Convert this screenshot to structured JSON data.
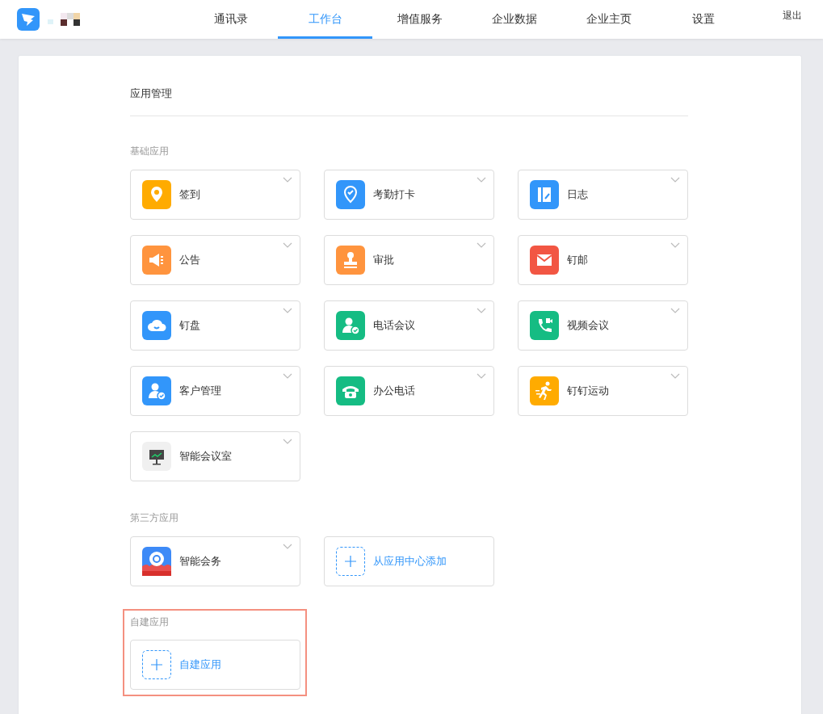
{
  "nav": {
    "tabs": [
      {
        "label": "通讯录",
        "selected": false
      },
      {
        "label": "工作台",
        "selected": true
      },
      {
        "label": "增值服务",
        "selected": false
      },
      {
        "label": "企业数据",
        "selected": false
      },
      {
        "label": "企业主页",
        "selected": false
      },
      {
        "label": "设置",
        "selected": false
      }
    ],
    "logout": "退出"
  },
  "panel": {
    "title": "应用管理",
    "sections": [
      {
        "title": "基础应用",
        "highlighted": false,
        "apps": [
          {
            "kind": "app",
            "name": "签到",
            "color": "#ffab00"
          },
          {
            "kind": "app",
            "name": "考勤打卡",
            "color": "#3296fa"
          },
          {
            "kind": "app",
            "name": "日志",
            "color": "#3296fa"
          },
          {
            "kind": "app",
            "name": "公告",
            "color": "#ff943e"
          },
          {
            "kind": "app",
            "name": "审批",
            "color": "#ff943e"
          },
          {
            "kind": "app",
            "name": "钉邮",
            "color": "#f25643"
          },
          {
            "kind": "app",
            "name": "钉盘",
            "color": "#3296fa"
          },
          {
            "kind": "app",
            "name": "电话会议",
            "color": "#15bc83"
          },
          {
            "kind": "app",
            "name": "视频会议",
            "color": "#15bc83"
          },
          {
            "kind": "app",
            "name": "客户管理",
            "color": "#3296fa"
          },
          {
            "kind": "app",
            "name": "办公电话",
            "color": "#15bc83"
          },
          {
            "kind": "app",
            "name": "钉钉运动",
            "color": "#ffab00"
          },
          {
            "kind": "app",
            "name": "智能会议室",
            "color": "#f0f0f0"
          }
        ]
      },
      {
        "title": "第三方应用",
        "highlighted": false,
        "apps": [
          {
            "kind": "app",
            "name": "智能会务",
            "color": "#3d8af7"
          },
          {
            "kind": "add",
            "name": "从应用中心添加"
          }
        ]
      },
      {
        "title": "自建应用",
        "highlighted": true,
        "apps": [
          {
            "kind": "add",
            "name": "自建应用"
          }
        ]
      }
    ]
  }
}
